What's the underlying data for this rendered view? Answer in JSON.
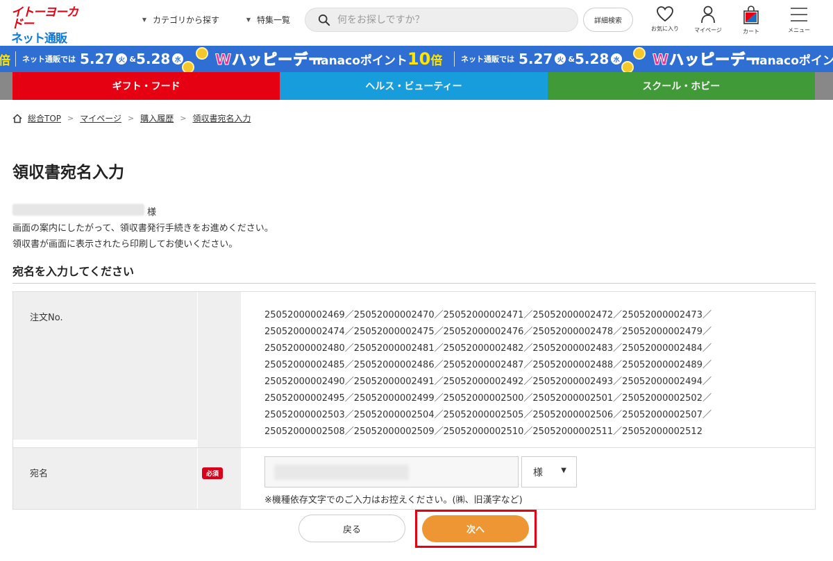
{
  "header": {
    "logo_line1": "イトーヨーカドー",
    "logo_line2": "ネット通販",
    "category_link": "カテゴリから探す",
    "feature_link": "特集一覧",
    "search_placeholder": "何をお探しですか？",
    "advanced_search": "詳細検索",
    "favorites": "お気に入り",
    "mypage": "マイページ",
    "cart": "カート",
    "menu": "メニュー"
  },
  "banner": {
    "prefix_label": "ネット通販では",
    "date1": "5.27",
    "day1": "火",
    "amp": "&",
    "date2": "5.28",
    "day2": "水",
    "w_happy": "Wハッピーデー",
    "nanaco": "nanacoポイント",
    "ten": "10",
    "bai": "倍",
    "edge_left": "倍",
    "tail": "nanacoポイン"
  },
  "categories": [
    {
      "label": "ギフト・フード"
    },
    {
      "label": "ヘルス・ビューティー"
    },
    {
      "label": "スクール・ホビー"
    }
  ],
  "breadcrumb": {
    "home": "総合TOP",
    "mypage": "マイページ",
    "history": "購入履歴",
    "current": "領収書宛名入力"
  },
  "page": {
    "title": "領収書宛名入力",
    "honorific": "様",
    "intro_line1": "画面の案内にしたがって、領収書発行手続きをお進めください。",
    "intro_line2": "領収書が画面に表示されたら印刷してお使いください。",
    "section_title": "宛名を入力してください"
  },
  "form": {
    "order_label": "注文No.",
    "order_numbers": [
      "25052000002469／25052000002470／25052000002471／25052000002472／25052000002473／",
      "25052000002474／25052000002475／25052000002476／25052000002478／25052000002479／",
      "25052000002480／25052000002481／25052000002482／25052000002483／25052000002484／",
      "25052000002485／25052000002486／25052000002487／25052000002488／25052000002489／",
      "25052000002490／25052000002491／25052000002492／25052000002493／25052000002494／",
      "25052000002495／25052000002499／25052000002500／25052000002501／25052000002502／",
      "25052000002503／25052000002504／25052000002505／25052000002506／25052000002507／",
      "25052000002508／25052000002509／25052000002510／25052000002511／25052000002512"
    ],
    "name_label": "宛名",
    "required_badge": "必須",
    "name_value": "",
    "honorific_select": "様",
    "note": "※機種依存文字でのご入力はお控えください。(㈱、旧漢字など)"
  },
  "buttons": {
    "back": "戻る",
    "next": "次へ"
  },
  "colors": {
    "brand_red": "#e60012",
    "brand_blue": "#0e7ad6",
    "gift_tab": "#e50012",
    "health_tab": "#179cdc",
    "school_tab": "#3f9a37",
    "banner_blue": "#2f6fd3",
    "next_button": "#ef9634",
    "required_badge": "#d9001b"
  }
}
